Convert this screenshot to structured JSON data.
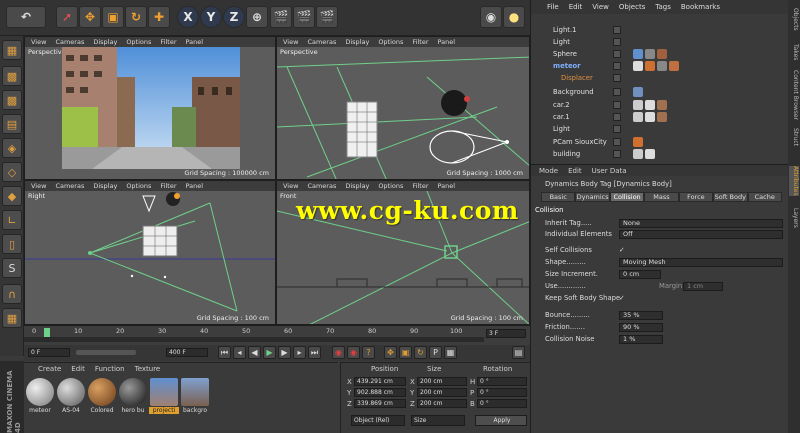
{
  "toolbar": {
    "xyz": [
      "X",
      "Y",
      "Z"
    ]
  },
  "viewports": [
    {
      "menu": [
        "View",
        "Cameras",
        "Display",
        "Options",
        "Filter",
        "Panel"
      ],
      "label": "Perspective",
      "grid": "Grid Spacing : 100000 cm"
    },
    {
      "menu": [
        "View",
        "Cameras",
        "Display",
        "Options",
        "Filter",
        "Panel"
      ],
      "label": "Perspective",
      "grid": "Grid Spacing : 1000 cm"
    },
    {
      "menu": [
        "View",
        "Cameras",
        "Display",
        "Options",
        "Filter",
        "Panel"
      ],
      "label": "Right",
      "grid": "Grid Spacing : 100 cm"
    },
    {
      "menu": [
        "View",
        "Cameras",
        "Display",
        "Options",
        "Filter",
        "Panel"
      ],
      "label": "Front",
      "grid": "Grid Spacing : 100 cm"
    }
  ],
  "watermark": "www.cg-ku.com",
  "timeline": {
    "ticks": [
      "0",
      "10",
      "20",
      "30",
      "40",
      "50",
      "60",
      "70",
      "80",
      "90",
      "100"
    ],
    "frame": "0 F",
    "current": "3 F",
    "start": "0 F",
    "end": "400 F"
  },
  "materials": {
    "menu": [
      "Create",
      "Edit",
      "Function",
      "Texture"
    ],
    "items": [
      "meteor",
      "AS-04",
      "Colored",
      "hero bu",
      "projecti",
      "backgro"
    ]
  },
  "coords": {
    "headers": [
      "Position",
      "Size",
      "Rotation"
    ],
    "rows": [
      [
        "X",
        "439.291 cm",
        "X",
        "200 cm",
        "H",
        "0 °"
      ],
      [
        "Y",
        "902.888 cm",
        "Y",
        "200 cm",
        "P",
        "0 °"
      ],
      [
        "Z",
        "339.869 cm",
        "Z",
        "200 cm",
        "B",
        "0 °"
      ]
    ],
    "mode": "Object (Rel)",
    "size_mode": "Size",
    "apply": "Apply"
  },
  "objects": {
    "menu": [
      "File",
      "Edit",
      "View",
      "Objects",
      "Tags",
      "Bookmarks"
    ],
    "items": [
      "Light.1",
      "Light",
      "Sphere",
      "meteor",
      "Displacer",
      "Background",
      "car.2",
      "car.1",
      "Light",
      "PCam SiouxCity",
      "building"
    ]
  },
  "attributes": {
    "menu": [
      "Mode",
      "Edit",
      "User Data"
    ],
    "title": "Dynamics Body Tag [Dynamics Body]",
    "tabs": [
      "Basic",
      "Dynamics",
      "Collision",
      "Mass",
      "Force",
      "Soft Body",
      "Cache"
    ],
    "section": "Collision",
    "inherit_tag_label": "Inherit Tag.....",
    "inherit_tag": "None",
    "individual_label": "Individual Elements",
    "individual": "Off",
    "self_collisions_label": "Self Collisions",
    "self_collisions": "✓",
    "shape_label": "Shape.........",
    "shape": "Moving Mesh",
    "size_inc_label": "Size Increment.",
    "size_inc": "0 cm",
    "use_label": "Use.............",
    "margin_label": "Margin",
    "margin": "1 cm",
    "keep_label": "Keep Soft Body Shape",
    "keep": "✓",
    "bounce_label": "Bounce.........",
    "bounce": "35 %",
    "friction_label": "Friction.......",
    "friction": "90 %",
    "noise_label": "Collision Noise",
    "noise": "1 %"
  },
  "side_tabs": [
    "Objects",
    "Takes",
    "Content Browser",
    "Struct",
    "Attributes",
    "Layers"
  ],
  "logo": "MAXON CINEMA 4D"
}
